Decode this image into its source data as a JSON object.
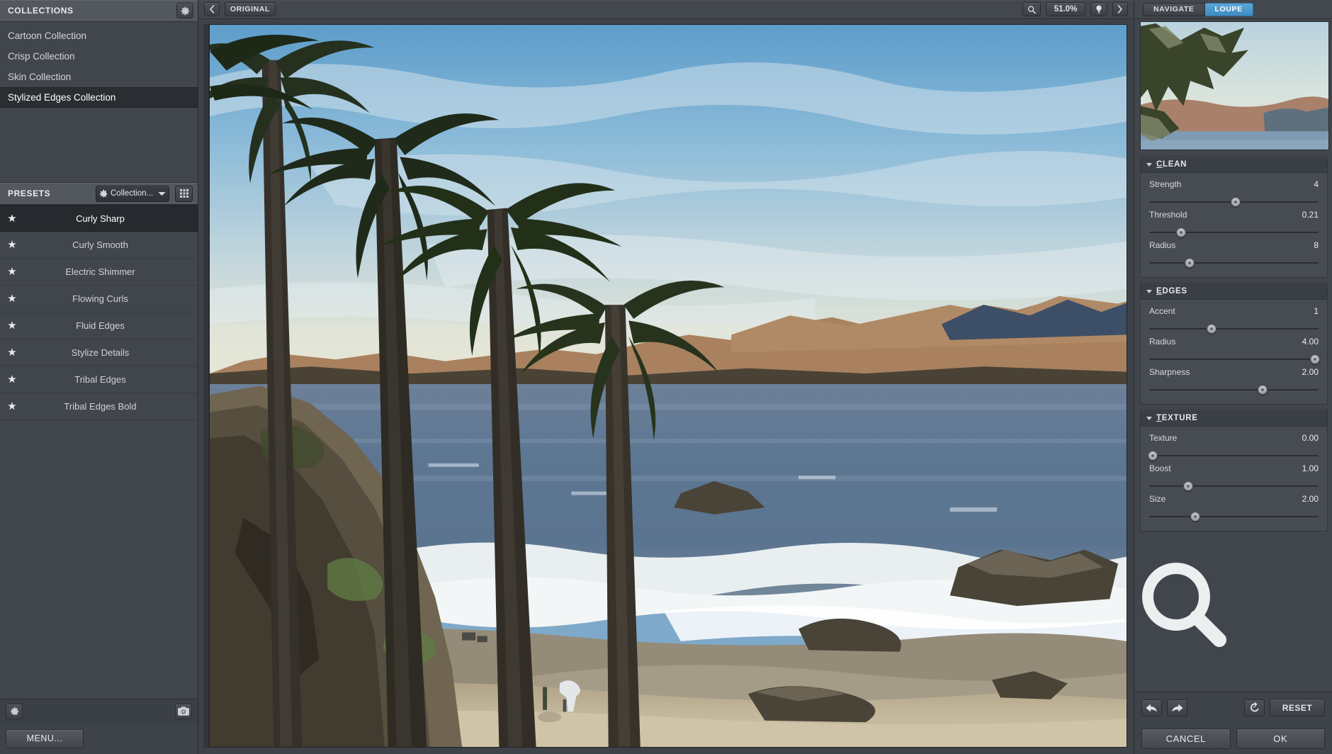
{
  "app": {
    "accent_blue": "#4a97cd",
    "panel_bg": "#41464c",
    "header_bg": "#53585e"
  },
  "left_panel": {
    "collections_header": {
      "title": "COLLECTIONS",
      "gear_icon": "gear-icon"
    },
    "collections": [
      {
        "label": "Cartoon Collection",
        "selected": false
      },
      {
        "label": "Crisp Collection",
        "selected": false
      },
      {
        "label": "Skin Collection",
        "selected": false
      },
      {
        "label": "Stylized Edges Collection",
        "selected": true
      }
    ],
    "presets_header": {
      "title": "PRESETS",
      "dropdown_label": "Collection...",
      "dropdown_gear_icon": "gear-icon",
      "dropdown_chevron_icon": "chevron-down-icon",
      "grid_view_icon": "grid-view-icon"
    },
    "presets": [
      {
        "star": "★",
        "label": "Curly Sharp",
        "selected": true
      },
      {
        "star": "★",
        "label": "Curly Smooth",
        "selected": false
      },
      {
        "star": "★",
        "label": "Electric Shimmer",
        "selected": false
      },
      {
        "star": "★",
        "label": "Flowing Curls",
        "selected": false
      },
      {
        "star": "★",
        "label": "Fluid Edges",
        "selected": false
      },
      {
        "star": "★",
        "label": "Stylize Details",
        "selected": false
      },
      {
        "star": "★",
        "label": "Tribal Edges",
        "selected": false
      },
      {
        "star": "★",
        "label": "Tribal Edges Bold",
        "selected": false
      }
    ],
    "bottom_bar": {
      "settings_icon": "gear-icon",
      "snapshot_icon": "camera-icon"
    },
    "menu_button": "MENU..."
  },
  "toolbar": {
    "back_icon": "chevron-left-icon",
    "original_label": "ORIGINAL",
    "zoom_icon": "magnifier-icon",
    "zoom_level": "51.0%",
    "preview_icon": "lightbulb-icon",
    "forward_icon": "chevron-right-icon"
  },
  "right_panel": {
    "tabs": [
      {
        "label": "NAVIGATE",
        "active": false
      },
      {
        "label": "LOUPE",
        "active": true
      }
    ],
    "sections": [
      {
        "title": "CLEAN",
        "accel": "C",
        "collapse_icon": "triangle-down-icon",
        "sliders": [
          {
            "label": "Strength",
            "value": "4",
            "pos": 51
          },
          {
            "label": "Threshold",
            "value": "0.21",
            "pos": 19
          },
          {
            "label": "Radius",
            "value": "8",
            "pos": 24
          }
        ]
      },
      {
        "title": "EDGES",
        "accel": "E",
        "collapse_icon": "triangle-down-icon",
        "sliders": [
          {
            "label": "Accent",
            "value": "1",
            "pos": 37
          },
          {
            "label": "Radius",
            "value": "4.00",
            "pos": 98
          },
          {
            "label": "Sharpness",
            "value": "2.00",
            "pos": 67
          }
        ]
      },
      {
        "title": "TEXTURE",
        "accel": "T",
        "collapse_icon": "triangle-down-icon",
        "sliders": [
          {
            "label": "Texture",
            "value": "0.00",
            "pos": 2
          },
          {
            "label": "Boost",
            "value": "1.00",
            "pos": 23
          },
          {
            "label": "Size",
            "value": "2.00",
            "pos": 27
          }
        ]
      }
    ],
    "bottom": {
      "undo_icon": "undo-arrow-icon",
      "redo_icon": "redo-arrow-icon",
      "revert_icon": "revert-icon",
      "reset_label": "RESET"
    },
    "actions": {
      "cancel_label": "CANCEL",
      "ok_label": "OK"
    }
  },
  "cursor": {
    "icon": "magnifier-cursor-icon"
  }
}
